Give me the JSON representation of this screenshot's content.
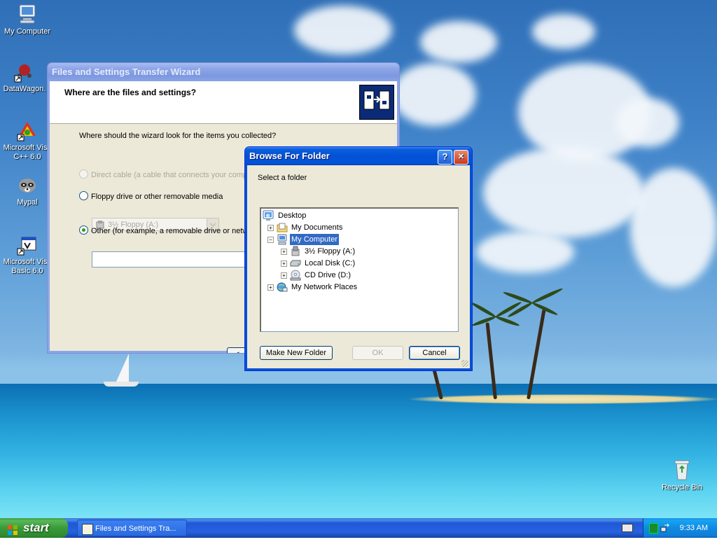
{
  "desktop": {
    "icons": [
      {
        "label": "My Computer"
      },
      {
        "label": "DataWagon."
      },
      {
        "label": "Microsoft Visu C++ 6.0"
      },
      {
        "label": "Mypal"
      },
      {
        "label": "Microsoft Visu Basic 6.0"
      },
      {
        "label": "Recycle Bin"
      }
    ]
  },
  "wizard": {
    "title": "Files and Settings Transfer Wizard",
    "header": "Where are the files and settings?",
    "question": "Where should the wizard look for the items you collected?",
    "options": [
      {
        "label": "Direct cable (a cable that connects your compu",
        "enabled": false,
        "selected": false
      },
      {
        "label": "Floppy drive or other removable media",
        "enabled": true,
        "selected": false
      },
      {
        "label": "Other (for example, a removable drive or netwo",
        "enabled": true,
        "selected": true
      }
    ],
    "drive_select": "3½ Floppy (A:)",
    "path_value": "",
    "back_button": "<"
  },
  "browse": {
    "title": "Browse For Folder",
    "help_button": "?",
    "close_button": "✕",
    "prompt": "Select a folder",
    "tree": [
      {
        "label": "Desktop",
        "icon": "desktop-icon",
        "expander": "",
        "level": 0
      },
      {
        "label": "My Documents",
        "icon": "folder-icon",
        "expander": "+",
        "level": 1
      },
      {
        "label": "My Computer",
        "icon": "computer-icon",
        "expander": "−",
        "level": 1,
        "selected": true
      },
      {
        "label": "3½ Floppy (A:)",
        "icon": "floppy-icon",
        "expander": "+",
        "level": 2
      },
      {
        "label": "Local Disk (C:)",
        "icon": "hard-disk-icon",
        "expander": "+",
        "level": 2
      },
      {
        "label": "CD Drive (D:)",
        "icon": "cd-drive-icon",
        "expander": "+",
        "level": 2
      },
      {
        "label": "My Network Places",
        "icon": "network-icon",
        "expander": "+",
        "level": 1
      }
    ],
    "make_new_folder": "Make New Folder",
    "ok": "OK",
    "cancel": "Cancel"
  },
  "taskbar": {
    "start": "start",
    "task": "Files and Settings Tra...",
    "clock": "9:33 AM"
  }
}
